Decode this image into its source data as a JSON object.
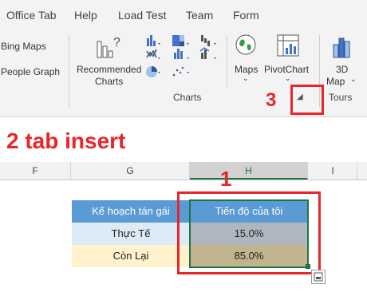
{
  "menu": {
    "tabs": [
      "Office Tab",
      "Help",
      "Load Test",
      "Team",
      "Form"
    ]
  },
  "ribbon": {
    "left_items": [
      "Bing Maps",
      "People Graph"
    ],
    "recommended_charts": [
      "Recommended",
      "Charts"
    ],
    "maps_label": "Maps",
    "pivotchart_label": "PivotChart",
    "threeD_label": [
      "3D",
      "Map"
    ],
    "charts_group": "Charts",
    "tours_group": "Tours"
  },
  "annotations": {
    "step1": "1",
    "step2": "2 tab insert",
    "step3": "3"
  },
  "sheet": {
    "columns": [
      "F",
      "G",
      "H",
      "I"
    ],
    "table": {
      "headers": [
        "Kế hoạch tán gái",
        "Tiến độ của tôi"
      ],
      "rows": [
        {
          "label": "Thực Tế",
          "value": "15.0%"
        },
        {
          "label": "Còn Lại",
          "value": "85.0%"
        }
      ]
    }
  },
  "colors": {
    "accent_red": "#e8262a",
    "header_blue": "#5b9bd5",
    "excel_green": "#217346"
  }
}
